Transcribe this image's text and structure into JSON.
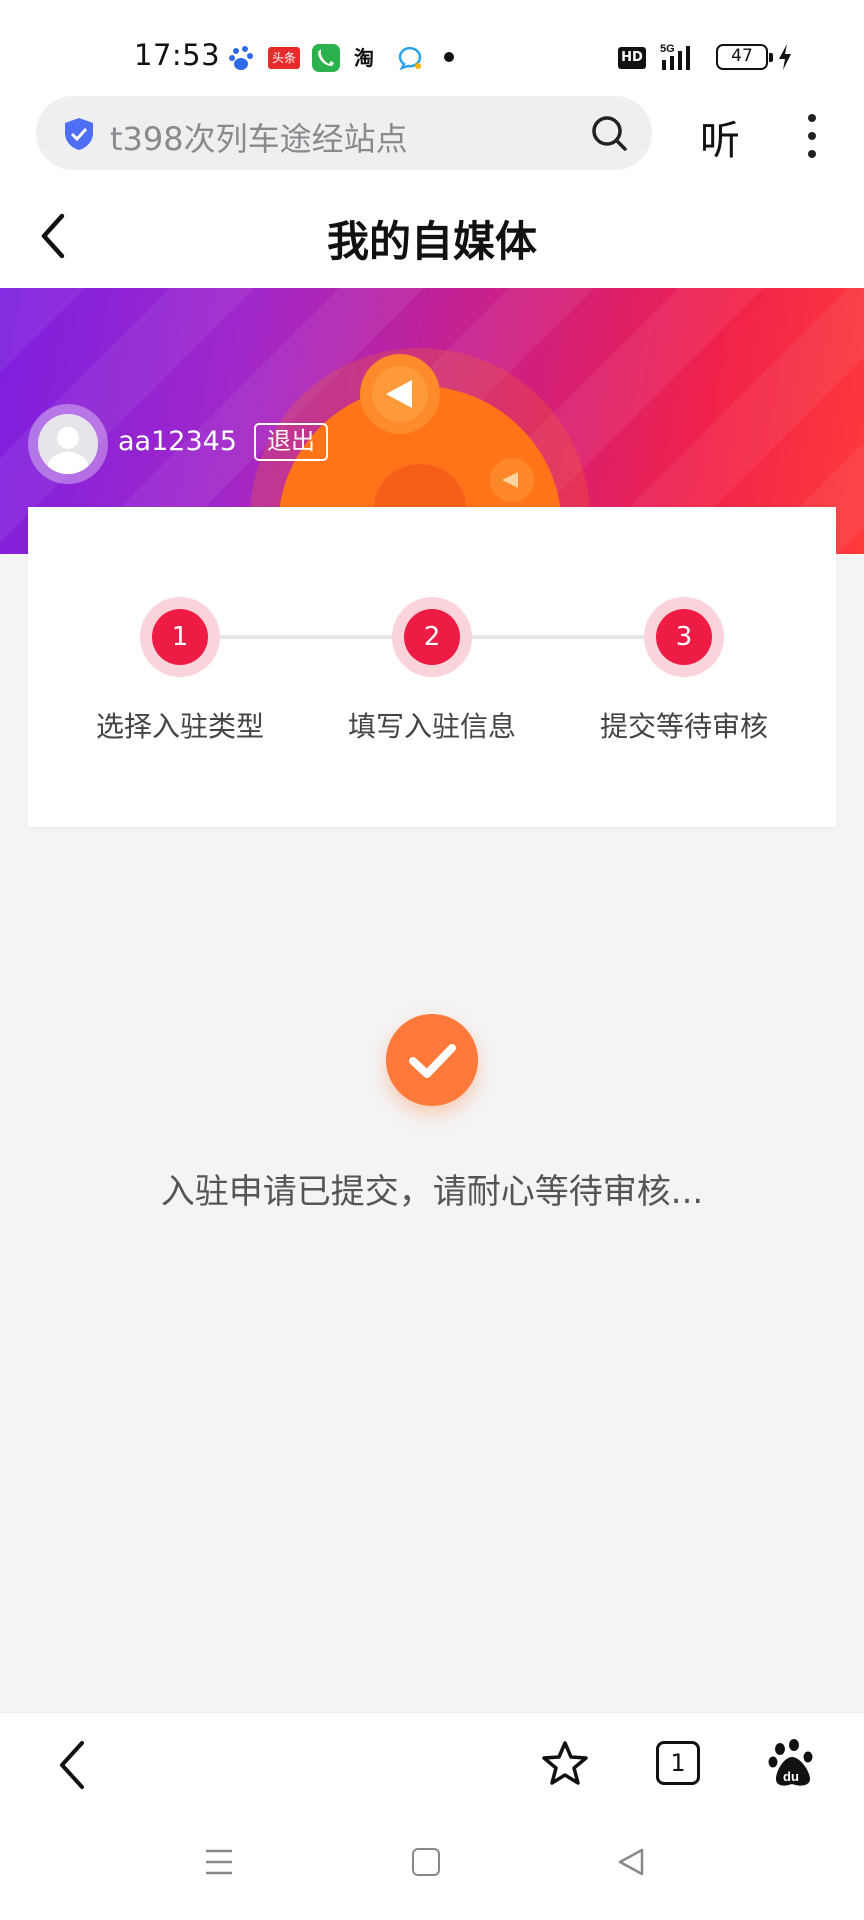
{
  "status_bar": {
    "time": "17:53",
    "toutiao_label": "头条",
    "taobao_label": "淘",
    "hd_label": "HD",
    "network_label": "5G",
    "battery_level": "47"
  },
  "search": {
    "query": "t398次列车途经站点",
    "listen_label": "听"
  },
  "header": {
    "title": "我的自媒体"
  },
  "profile": {
    "username": "aa12345",
    "logout_label": "退出"
  },
  "steps": [
    {
      "number": "1",
      "label": "选择入驻类型"
    },
    {
      "number": "2",
      "label": "填写入驻信息"
    },
    {
      "number": "3",
      "label": "提交等待审核"
    }
  ],
  "result": {
    "message": "入驻申请已提交，请耐心等待审核..."
  },
  "browser_bar": {
    "tab_count": "1"
  },
  "colors": {
    "accent_red": "#ee1c44",
    "success_orange": "#ff7a3a",
    "banner_start": "#7d1fe0",
    "banner_end": "#ff3a3a"
  },
  "icons": [
    "baidu-icon",
    "phone-icon",
    "chat-icon",
    "shield-icon",
    "search-icon",
    "more-icon",
    "back-arrow-icon",
    "check-icon",
    "star-icon",
    "menu-icon",
    "home-icon"
  ]
}
